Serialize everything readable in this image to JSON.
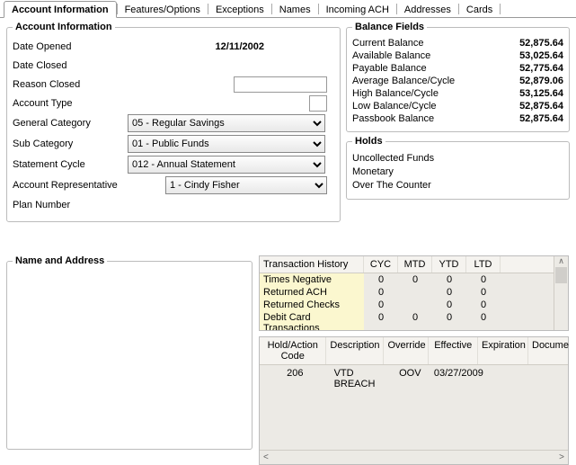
{
  "tabs": [
    "Account Information",
    "Features/Options",
    "Exceptions",
    "Names",
    "Incoming ACH",
    "Addresses",
    "Cards"
  ],
  "acct": {
    "legend": "Account Information",
    "date_opened_label": "Date Opened",
    "date_opened": "12/11/2002",
    "date_closed_label": "Date Closed",
    "reason_closed_label": "Reason Closed",
    "reason_closed": "",
    "account_type_label": "Account Type",
    "account_type": "",
    "gen_cat_label": "General Category",
    "gen_cat": "05 - Regular Savings",
    "sub_cat_label": "Sub Category",
    "sub_cat": "01 - Public Funds",
    "stmt_cycle_label": "Statement Cycle",
    "stmt_cycle": "012 - Annual Statement",
    "acct_rep_label": "Account Representative",
    "acct_rep": "1 - Cindy Fisher",
    "plan_number_label": "Plan Number"
  },
  "balance": {
    "legend": "Balance Fields",
    "rows": [
      {
        "label": "Current Balance",
        "value": "52,875.64"
      },
      {
        "label": "Available Balance",
        "value": "53,025.64"
      },
      {
        "label": "Payable Balance",
        "value": "52,775.64"
      },
      {
        "label": "Average Balance/Cycle",
        "value": "52,879.06"
      },
      {
        "label": "High Balance/Cycle",
        "value": "53,125.64"
      },
      {
        "label": "Low Balance/Cycle",
        "value": "52,875.64"
      },
      {
        "label": "Passbook Balance",
        "value": "52,875.64"
      }
    ]
  },
  "holds": {
    "legend": "Holds",
    "rows": [
      "Uncollected Funds",
      "Monetary",
      "Over The Counter"
    ]
  },
  "name_addr_legend": "Name and Address",
  "trans_history": {
    "headers": [
      "Transaction History",
      "CYC",
      "MTD",
      "YTD",
      "LTD"
    ],
    "rows": [
      {
        "label": "Times Negative",
        "cyc": "0",
        "mtd": "0",
        "ytd": "0",
        "ltd": "0"
      },
      {
        "label": "Returned ACH",
        "cyc": "0",
        "mtd": "",
        "ytd": "0",
        "ltd": "0"
      },
      {
        "label": "Returned Checks",
        "cyc": "0",
        "mtd": "",
        "ytd": "0",
        "ltd": "0"
      },
      {
        "label": "Debit Card Transactions",
        "cyc": "0",
        "mtd": "0",
        "ytd": "0",
        "ltd": "0"
      }
    ]
  },
  "hold_action": {
    "headers": [
      "Hold/Action Code",
      "Description",
      "Override",
      "Effective",
      "Expiration",
      "Docume"
    ],
    "rows": [
      {
        "code": "206",
        "desc": "VTD BREACH",
        "override": "OOV",
        "effective": "03/27/2009",
        "expiration": "",
        "doc": ""
      }
    ]
  }
}
